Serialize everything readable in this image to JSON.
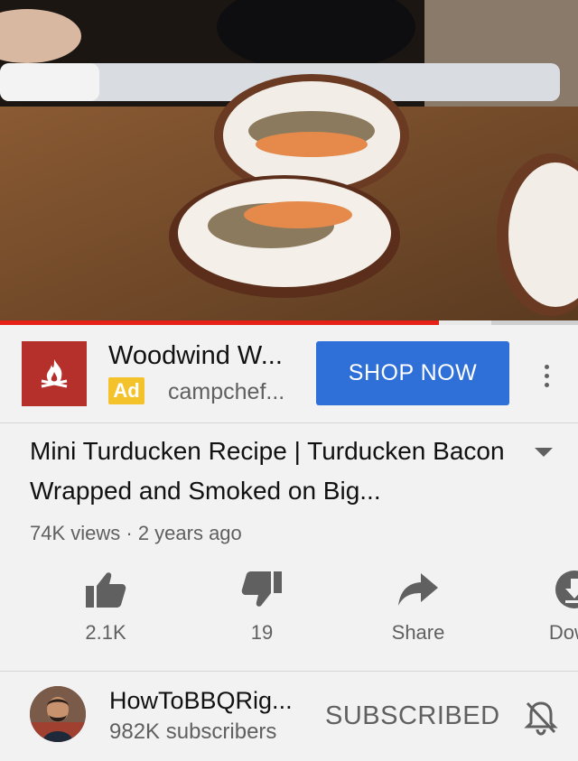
{
  "player": {
    "progress_percent": 76,
    "buffered_percent": 85
  },
  "ad": {
    "title": "Woodwind W...",
    "badge": "Ad",
    "domain": "campchef...",
    "cta": "SHOP NOW",
    "logo_color": "#b5302b",
    "cta_color": "#2f6fd8",
    "badge_color": "#f4c22b"
  },
  "video": {
    "title": "Mini Turducken Recipe | Turducken Bacon Wrapped and Smoked on Big...",
    "meta": "74K views · 2 years ago"
  },
  "actions": [
    {
      "icon": "thumbs-up-icon",
      "label": "2.1K"
    },
    {
      "icon": "thumbs-down-icon",
      "label": "19"
    },
    {
      "icon": "share-icon",
      "label": "Share"
    },
    {
      "icon": "download-icon",
      "label": "Down"
    }
  ],
  "channel": {
    "name": "HowToBBQRig...",
    "subscribers": "982K subscribers",
    "subscribe_state": "SUBSCRIBED"
  },
  "colors": {
    "progress": "#e62117",
    "secondary_text": "#606060",
    "background": "#f2f2f2"
  }
}
